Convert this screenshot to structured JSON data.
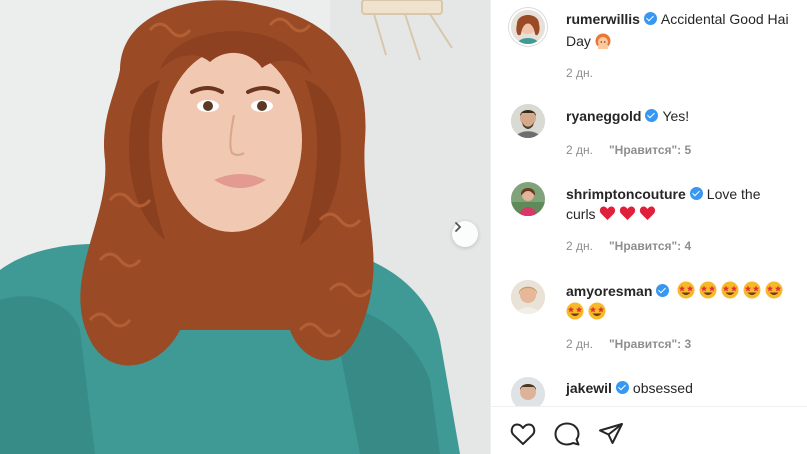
{
  "post": {
    "author": "rumerwillis",
    "caption": "Accidental Good Hai",
    "caption_line2": "Day",
    "caption_emoji": "redhead-woman-emoji",
    "time": "2 дн."
  },
  "comments": [
    {
      "user": "ryaneggold",
      "text": "Yes!",
      "time": "2 дн.",
      "likes": "\"Нравится\": 5"
    },
    {
      "user": "shrimptoncouture",
      "text": "Love the",
      "text_line2": "curls",
      "emoji": "red-heart-emoji x3",
      "time": "2 дн.",
      "likes": "\"Нравится\": 4"
    },
    {
      "user": "amyoresman",
      "text": "",
      "emoji": "star-struck-emoji x7",
      "time": "2 дн.",
      "likes": "\"Нравится\": 3"
    },
    {
      "user": "jakewil",
      "text": "obsessed"
    }
  ],
  "icons": {
    "next": "chevron-right-icon",
    "like": "heart-icon",
    "comment": "comment-icon",
    "share": "paper-plane-icon"
  },
  "colors": {
    "verified": "#3897f0",
    "meta": "#8e8e8e",
    "sweater": "#3f9a96",
    "hair": "#9a4a25"
  }
}
